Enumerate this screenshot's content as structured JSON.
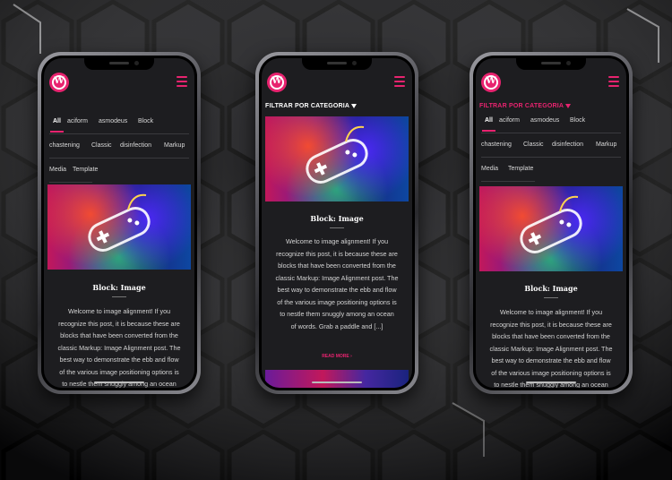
{
  "colors": {
    "accent": "#e8236f",
    "screen_bg": "#1d1d20",
    "page_bg": "#0b0b0d"
  },
  "logo": {
    "icon": "wordpress-logo-icon",
    "glyph": "W"
  },
  "menu": {
    "icon": "hamburger-menu-icon"
  },
  "filter": {
    "label": "FILTRAR POR CATEGORIA",
    "icon": "filter-funnel-icon"
  },
  "categories": [
    [
      "All",
      "aciform",
      "asmodeus",
      "Block"
    ],
    [
      "chastening",
      "Classic",
      "disinfection",
      "Markup"
    ],
    [
      "Media",
      "Template"
    ]
  ],
  "active_category": "All",
  "post": {
    "title": "Block: Image",
    "image_icon": "game-controller-image",
    "excerpt_lines": [
      "Welcome to image alignment! If you",
      "recognize this post, it is because these are",
      "blocks that have been converted from the",
      "classic Markup: Image Alignment post. The",
      "best way to demonstrate the ebb and flow",
      "of the various image positioning options is",
      "to nestle them snuggly among an ocean"
    ],
    "excerpt_lines_mid": [
      "Welcome to image alignment! If you",
      "recognize this post, it is because these are",
      "blocks that have been converted from the",
      "classic Markup: Image Alignment post. The",
      "best way to demonstrate the ebb and flow",
      "of the various image positioning options is",
      "to nestle them snuggly among an ocean",
      "of words. Grab a paddle and [...]"
    ],
    "read_more": "READ MORE ›"
  }
}
